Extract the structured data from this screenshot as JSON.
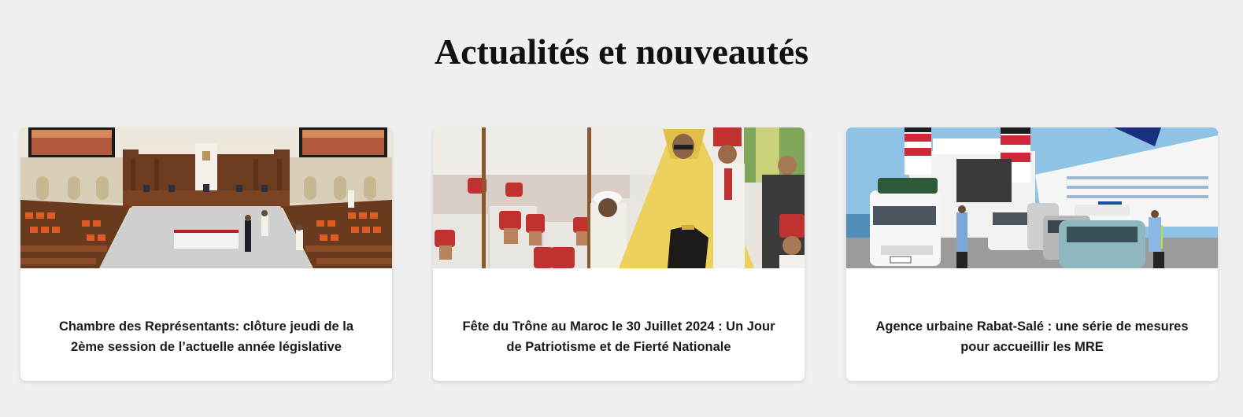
{
  "section": {
    "title": "Actualités et nouveautés"
  },
  "cards": [
    {
      "title": "Chambre des Représentants: clôture jeudi de la 2ème session de l’actuelle année législative",
      "image": "parliament-chamber-photo"
    },
    {
      "title": "Fête du Trône au Maroc le 30 Juillet 2024 : Un Jour de Patriotisme et de Fierté Nationale",
      "image": "throne-day-ceremony-photo"
    },
    {
      "title": "Agence urbaine Rabat-Salé : une série de mesures pour accueillir les MRE",
      "image": "ferry-port-vehicles-photo"
    }
  ]
}
